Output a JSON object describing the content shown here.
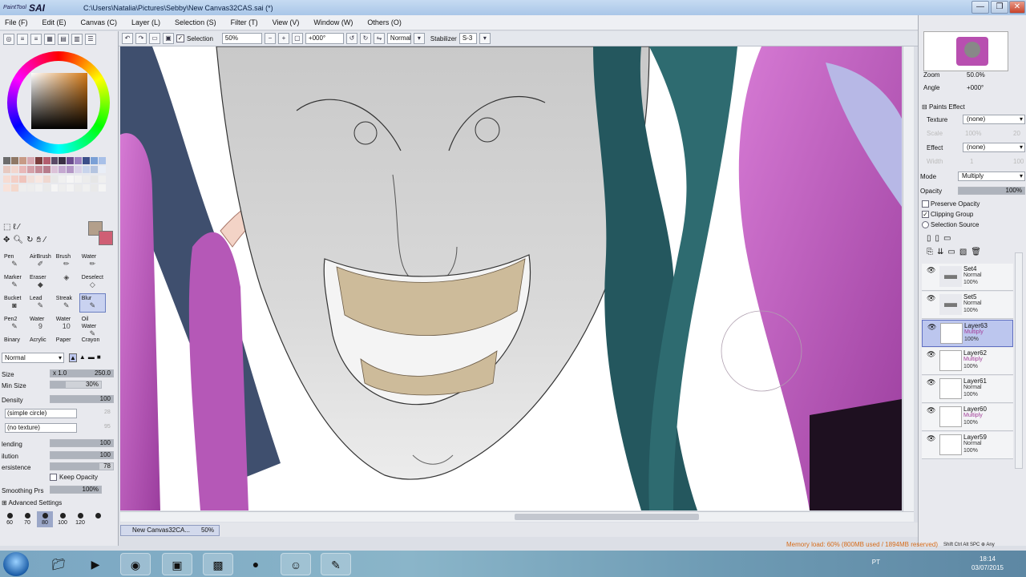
{
  "window": {
    "brand_small": "PaintTool",
    "brand_big": "SAI",
    "title": "C:\\Users\\Natalia\\Pictures\\Sebby\\New Canvas32CAS.sai (*)",
    "min_label": "—",
    "max_label": "❐",
    "close_label": "✕"
  },
  "menu": {
    "items": [
      "File (F)",
      "Edit (E)",
      "Canvas (C)",
      "Layer (L)",
      "Selection (S)",
      "Filter (T)",
      "View (V)",
      "Window (W)",
      "Others (O)"
    ]
  },
  "toolbar": {
    "selection_label": "Selection",
    "zoom_value": "50%",
    "angle_value": "+000°",
    "blend_mode": "Normal",
    "stabilizer_label": "Stabilizer",
    "stabilizer_value": "S-3"
  },
  "tools": [
    {
      "label": "Pen",
      "icon": "✎"
    },
    {
      "label": "AirBrush",
      "icon": "✐"
    },
    {
      "label": "Brush",
      "icon": "✏"
    },
    {
      "label": "Water",
      "icon": "✏"
    },
    {
      "label": "Marker",
      "icon": "✎"
    },
    {
      "label": "Eraser",
      "icon": "◆"
    },
    {
      "label": "",
      "icon": "◈"
    },
    {
      "label": "Deselect",
      "icon": "◇"
    },
    {
      "label": "Bucket",
      "icon": "◙"
    },
    {
      "label": "Lead",
      "icon": "✎"
    },
    {
      "label": "Streak",
      "icon": "✎"
    },
    {
      "label": "Blur",
      "icon": "✎"
    },
    {
      "label": "Pen2",
      "icon": "✎"
    },
    {
      "label": "Water",
      "icon": "9"
    },
    {
      "label": "Water",
      "icon": "10"
    },
    {
      "label": "Oil Water",
      "icon": "✎"
    },
    {
      "label": "Binary",
      "icon": ""
    },
    {
      "label": "Acrylic",
      "icon": ""
    },
    {
      "label": "Paper",
      "icon": ""
    },
    {
      "label": "Crayon",
      "icon": ""
    }
  ],
  "brush": {
    "blend": "Normal",
    "size_label": "Size",
    "size_mult": "x 1.0",
    "size_value": "250.0",
    "min_size_label": "Min Size",
    "min_size_value": "30%",
    "density_label": "Density",
    "density_value": "100",
    "shape": "(simple circle)",
    "shape_value": "28",
    "texture": "(no texture)",
    "texture_value": "95",
    "blending_label": "lending",
    "blending_value": "100",
    "dilution_label": "ilution",
    "dilution_value": "100",
    "persistence_label": "ersistence",
    "persistence_value": "78",
    "keep_opacity_label": "Keep Opacity",
    "smoothing_label": "Smoothing Prs",
    "smoothing_value": "100%",
    "advanced_label": "Advanced Settings",
    "preset_sizes": [
      "60",
      "70",
      "80",
      "100",
      "120",
      ""
    ]
  },
  "right": {
    "zoom_label": "Zoom",
    "zoom_value": "50.0%",
    "angle_label": "Angle",
    "angle_value": "+000°",
    "paints_effect_label": "Paints Effect",
    "texture_label": "Texture",
    "texture_value": "(none)",
    "scale_label": "Scale",
    "scale_value": "100%",
    "scale_num": "20",
    "effect_label": "Effect",
    "effect_value": "(none)",
    "width_label": "Width",
    "width_value": "1",
    "width_num": "100",
    "mode_label": "Mode",
    "mode_value": "Multiply",
    "opacity_label": "Opacity",
    "opacity_value": "100%",
    "preserve_opacity_label": "Preserve Opacity",
    "clipping_group_label": "Clipping Group",
    "selection_source_label": "Selection Source"
  },
  "layers": [
    {
      "name": "Set4",
      "mode": "Normal",
      "opacity": "100%",
      "folder": true,
      "active": false,
      "multiply": false
    },
    {
      "name": "Set5",
      "mode": "Normal",
      "opacity": "100%",
      "folder": true,
      "active": false,
      "multiply": false
    },
    {
      "name": "Layer63",
      "mode": "Multiply",
      "opacity": "100%",
      "folder": false,
      "active": true,
      "multiply": true
    },
    {
      "name": "Layer62",
      "mode": "Multiply",
      "opacity": "100%",
      "folder": false,
      "active": false,
      "multiply": true
    },
    {
      "name": "Layer61",
      "mode": "Normal",
      "opacity": "100%",
      "folder": false,
      "active": false,
      "multiply": false
    },
    {
      "name": "Layer60",
      "mode": "Multiply",
      "opacity": "100%",
      "folder": false,
      "active": false,
      "multiply": true
    },
    {
      "name": "Layer59",
      "mode": "Normal",
      "opacity": "100%",
      "folder": false,
      "active": false,
      "multiply": false
    }
  ],
  "document_tab": {
    "name": "New Canvas32CA...",
    "zoom": "50%"
  },
  "status": {
    "memory": "Memory load: 60% (800MB used / 1894MB reserved)",
    "keys": "Shift Ctrl Alt SPC ⊕ Any"
  },
  "taskbar": {
    "lang": "PT",
    "time": "18:14",
    "date": "03/07/2015"
  },
  "colors": {
    "primary": "#b39f8b",
    "secondary": "#cf5e74",
    "robe": "#c25ec4",
    "hair": "#24575e"
  }
}
